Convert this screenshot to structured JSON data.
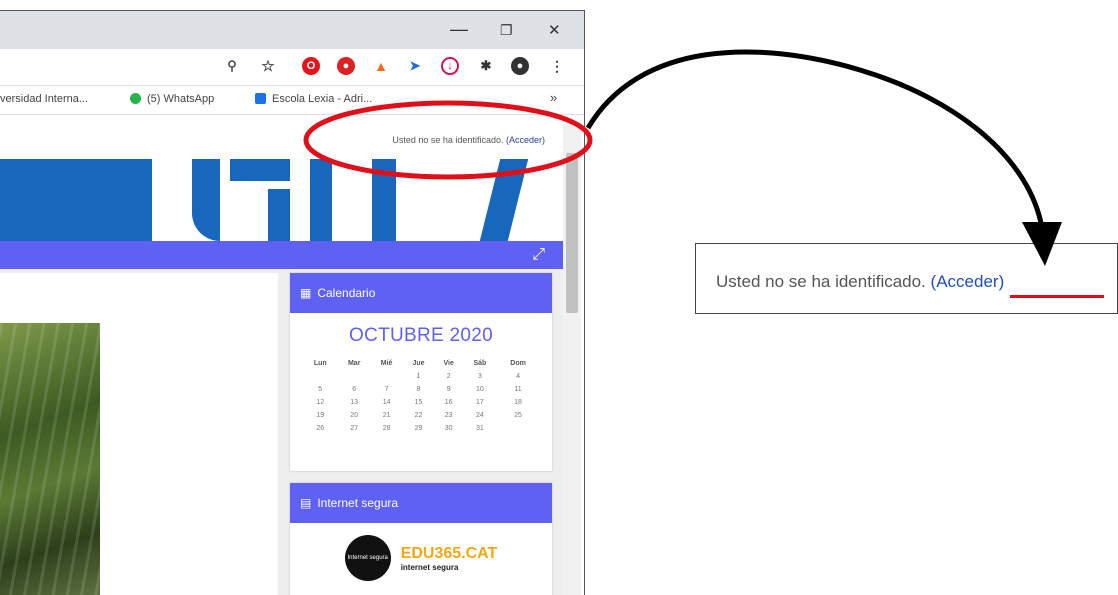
{
  "browser": {
    "window_controls": {
      "minimize": "—",
      "restore": "❐",
      "close": "✕"
    },
    "toolbar_icons": [
      "zoom-icon",
      "star-icon",
      "opera-icon",
      "adblock-icon",
      "fire-icon",
      "bird-icon",
      "download-icon",
      "puzzle-icon",
      "profile-icon",
      "menu-dots-icon"
    ],
    "bookmarks": [
      {
        "label": "versidad Interna...",
        "color": "#ffffff"
      },
      {
        "label": "(5) WhatsApp",
        "color": "#25b34a"
      },
      {
        "label": "Escola Lexia - Adri...",
        "color": "#1a73e8"
      }
    ],
    "bookmarks_overflow": "»"
  },
  "page": {
    "login_status": "Usted no se ha identificado.",
    "login_link": "(Acceder)",
    "calendar": {
      "header": "Calendario",
      "month": "OCTUBRE 2020",
      "weekdays": [
        "Lun",
        "Mar",
        "Mié",
        "Jue",
        "Vie",
        "Sáb",
        "Dom"
      ],
      "weeks": [
        [
          "",
          "",
          "",
          "1",
          "2",
          "3",
          "4"
        ],
        [
          "5",
          "6",
          "7",
          "8",
          "9",
          "10",
          "11"
        ],
        [
          "12",
          "13",
          "14",
          "15",
          "16",
          "17",
          "18"
        ],
        [
          "19",
          "20",
          "21",
          "22",
          "23",
          "24",
          "25"
        ],
        [
          "26",
          "27",
          "28",
          "29",
          "30",
          "31",
          ""
        ]
      ]
    },
    "internet_card": {
      "header": "Internet segura",
      "logo1": "Internet segura",
      "logo2_main": "EDU365.CAT",
      "logo2_sub": "internet segura"
    }
  },
  "callout": {
    "text": "Usted no se ha identificado.",
    "link": "(Acceder)"
  },
  "colors": {
    "accent": "#5e61f2",
    "banner_blue": "#1767bd",
    "highlight_red": "#e0101a"
  }
}
